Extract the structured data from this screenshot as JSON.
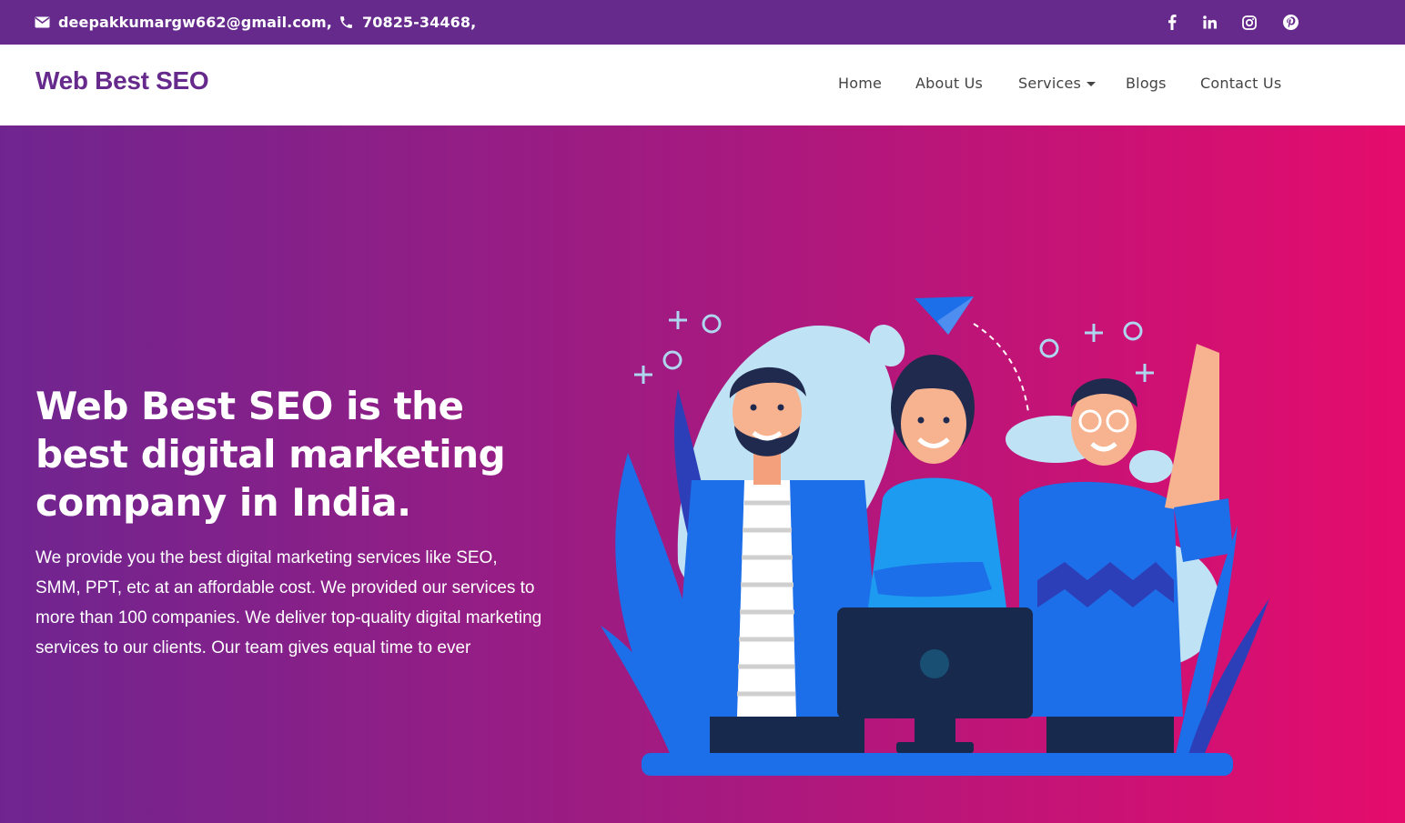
{
  "topbar": {
    "email": "deepakkumargw662@gmail.com,",
    "phone": "70825-34468,",
    "social": [
      "facebook-icon",
      "linkedin-icon",
      "instagram-icon",
      "pinterest-icon"
    ]
  },
  "nav": {
    "logo": "Web Best SEO",
    "items": [
      {
        "label": "Home"
      },
      {
        "label": "About Us"
      },
      {
        "label": "Services"
      },
      {
        "label": "Blogs"
      },
      {
        "label": "Contact Us"
      }
    ]
  },
  "hero": {
    "title": "Web Best SEO is the best digital marketing company in India.",
    "text": "We provide you the best digital marketing services like SEO, SMM, PPT, etc at an affordable cost. We provided our services to more than 100 companies. We deliver top-quality digital marketing services to our clients. Our team gives equal time to ever"
  },
  "colors": {
    "brand_purple": "#662a8d",
    "gradient_start": "#6f2590",
    "gradient_end": "#e50c6c",
    "illustration_blue": "#1c6fe8",
    "illustration_dark": "#172a4e"
  }
}
